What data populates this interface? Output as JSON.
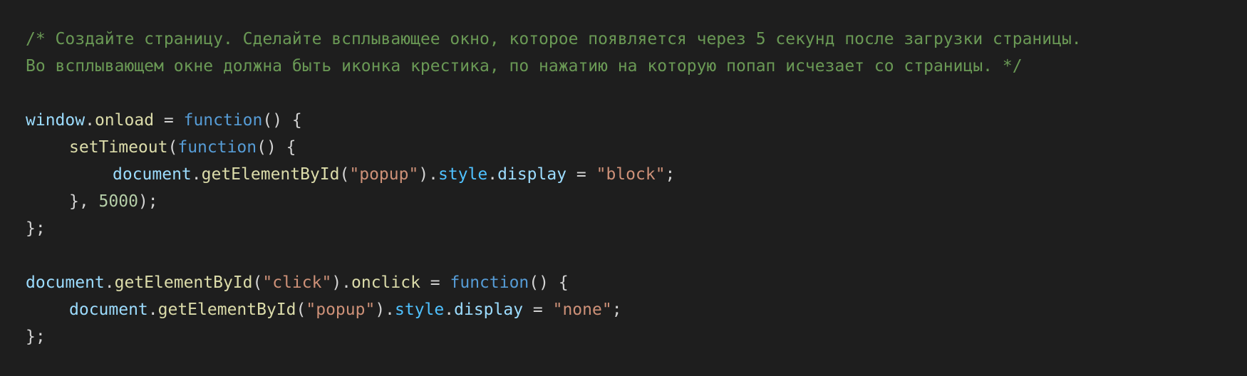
{
  "comment": {
    "line1": "/* Создайте страницу. Сделайте всплывающее окно, которое появляется через 5 секунд после загрузки страницы.",
    "line2": "Во всплывающем окне должна быть иконка крестика, по нажатию на которую попап исчезает со страницы. */"
  },
  "code": {
    "window": "window",
    "onload": "onload",
    "function_kw": "function",
    "setTimeout": "setTimeout",
    "document": "document",
    "getElementById": "getElementById",
    "popup_str": "\"popup\"",
    "click_str": "\"click\"",
    "style": "style",
    "display": "display",
    "block_str": "\"block\"",
    "none_str": "\"none\"",
    "delay": "5000",
    "onclick": "onclick"
  },
  "colors": {
    "background": "#1e1e1e",
    "comment": "#6a9955",
    "variable": "#9cdcfe",
    "function": "#dcdcaa",
    "keyword": "#569cd6",
    "string": "#ce9178",
    "number": "#b5cea8",
    "property": "#4fc1ff",
    "text": "#d4d4d4"
  }
}
